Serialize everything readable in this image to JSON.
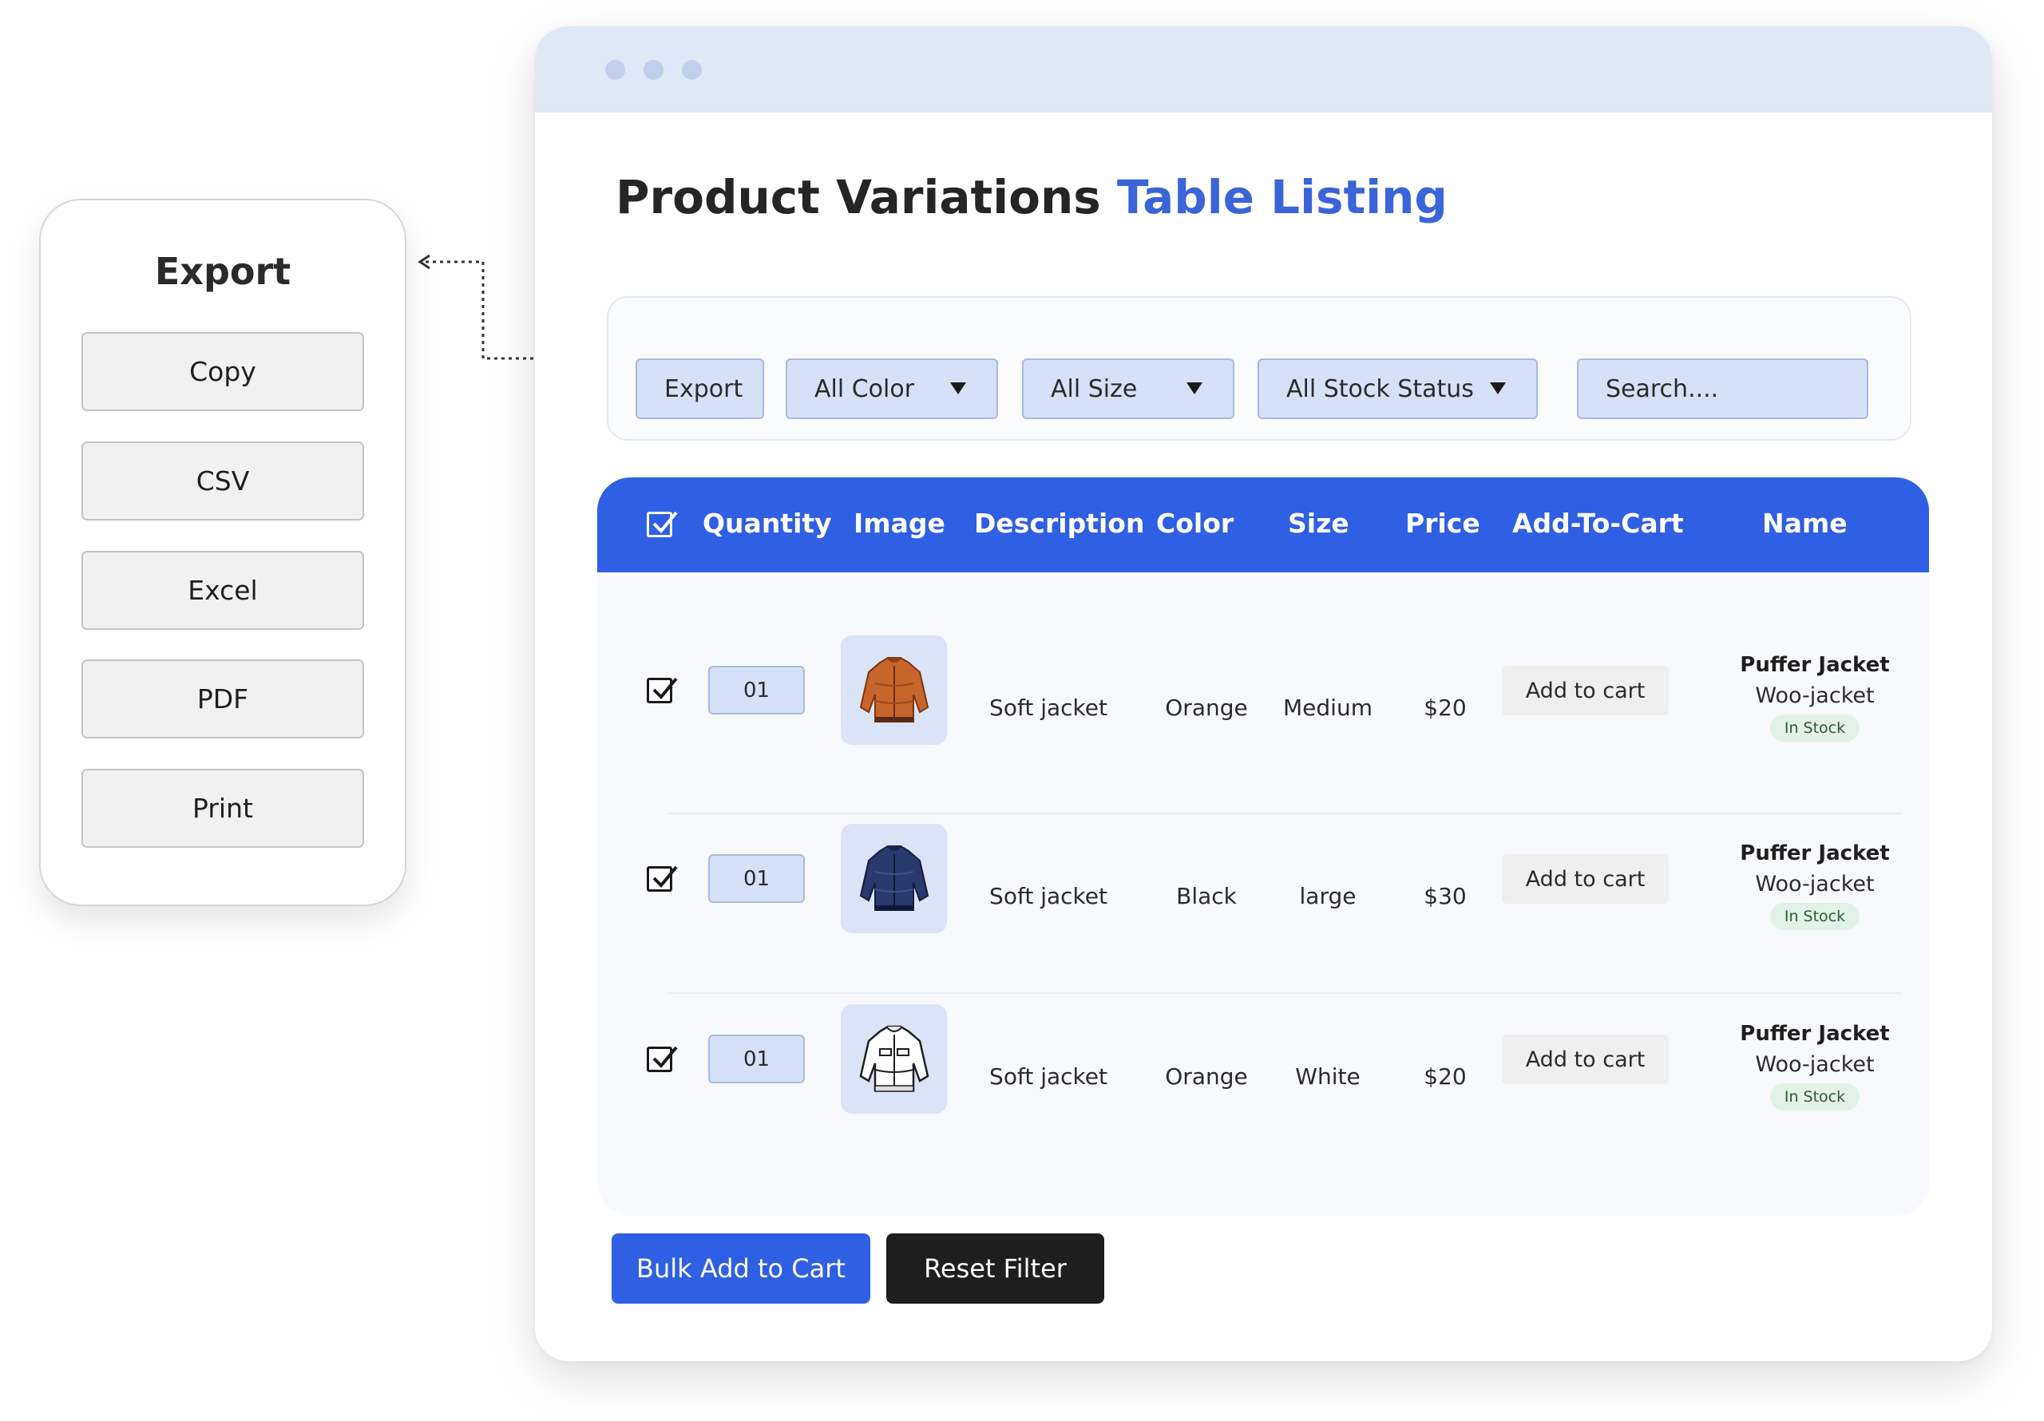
{
  "export_panel": {
    "title": "Export",
    "options": [
      "Copy",
      "CSV",
      "Excel",
      "PDF",
      "Print"
    ]
  },
  "page": {
    "title_main": "Product Variations",
    "title_accent": "Table Listing"
  },
  "filters": {
    "export_label": "Export",
    "color_selected": "All Color",
    "size_selected": "All Size",
    "stock_selected": "All Stock Status",
    "search_placeholder": "Search...."
  },
  "table": {
    "headers": [
      "Quantity",
      "Image",
      "Description",
      "Color",
      "Size",
      "Price",
      "Add-To-Cart",
      "Name"
    ],
    "rows": [
      {
        "quantity": "01",
        "image": "orange-jacket-image",
        "description": "Soft jacket",
        "color": "Orange",
        "size": "Medium",
        "price": "$20",
        "cart_label": "Add to cart",
        "name": "Puffer Jacket",
        "sku": "Woo-jacket",
        "stock": "In Stock"
      },
      {
        "quantity": "01",
        "image": "navy-jacket-image",
        "description": "Soft jacket",
        "color": "Black",
        "size": "large",
        "price": "$30",
        "cart_label": "Add to cart",
        "name": "Puffer Jacket",
        "sku": "Woo-jacket",
        "stock": "In Stock"
      },
      {
        "quantity": "01",
        "image": "white-jacket-image",
        "description": "Soft jacket",
        "color": "Orange",
        "size": "White",
        "price": "$20",
        "cart_label": "Add to cart",
        "name": "Puffer Jacket",
        "sku": "Woo-jacket",
        "stock": "In Stock"
      }
    ]
  },
  "actions": {
    "bulk_label": "Bulk Add to Cart",
    "reset_label": "Reset Filter"
  },
  "colors": {
    "accent": "#2f5fe3",
    "title_accent": "#3a64d8",
    "control_bg": "#d6e0f7",
    "titlebar": "#dfe8f5",
    "badge_bg": "#e3f2e7"
  }
}
